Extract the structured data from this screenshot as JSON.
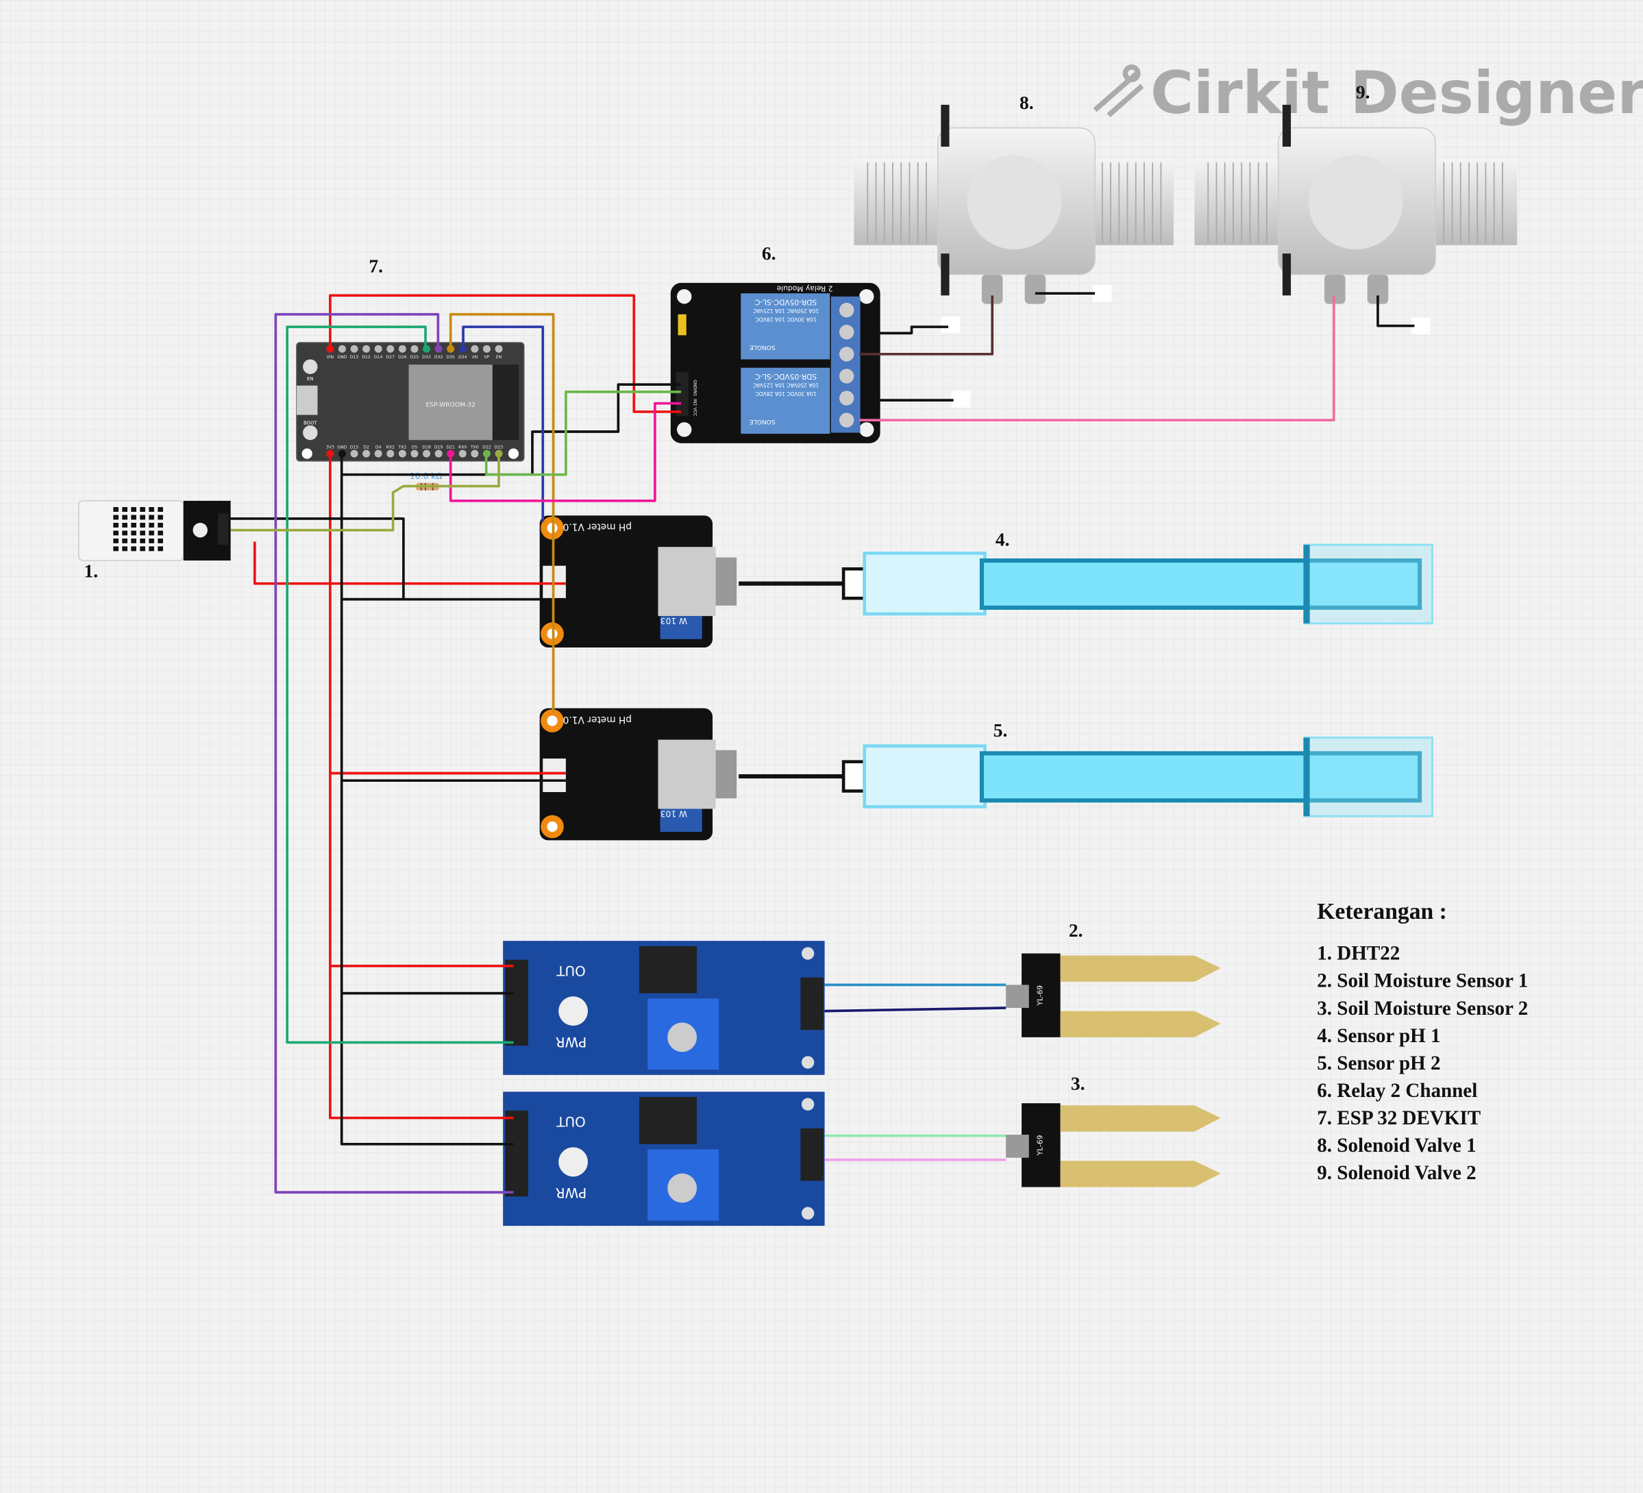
{
  "watermark": {
    "brand": "Cirkit Designer"
  },
  "component_labels": {
    "dht22": "1.",
    "soil1": "2.",
    "soil2": "3.",
    "ph1": "4.",
    "ph2": "5.",
    "relay": "6.",
    "esp32": "7.",
    "valve1": "8.",
    "valve2": "9."
  },
  "resistor": {
    "value": "10.0 kΩ"
  },
  "esp32": {
    "top_pins": [
      "VIN",
      "GND",
      "D13",
      "D12",
      "D14",
      "D27",
      "D26",
      "D25",
      "D33",
      "D32",
      "D35",
      "D34",
      "VN",
      "VP",
      "EN"
    ],
    "bottom_pins": [
      "3V3",
      "GND",
      "D15",
      "D2",
      "D4",
      "RX2",
      "TX2",
      "D5",
      "D18",
      "D19",
      "D21",
      "RX0",
      "TX0",
      "D22",
      "D23"
    ],
    "buttons": [
      "EN",
      "BOOT"
    ],
    "module": "ESP-WROOM-32"
  },
  "relay": {
    "title": "2 Relay Module",
    "relay_text": [
      "SDR-05VDC-SL-C",
      "10A 250VAC 10A 125VAC",
      "10A 30VDC 10A 28VDC",
      "SONGLE"
    ],
    "inputs": [
      "GND",
      "IN1",
      "IN2",
      "VCC"
    ]
  },
  "ph_sensor": {
    "title": "pH meter V1.0",
    "pot": "W 103"
  },
  "soil_module": {
    "labels": [
      "OUT",
      "PWR"
    ]
  },
  "soil_probe": {
    "label": "YL-69"
  },
  "legend": {
    "title": "Keterangan :",
    "items": [
      "1. DHT22",
      "2. Soil Moisture Sensor 1",
      "3. Soil Moisture Sensor 2",
      "4. Sensor pH 1",
      "5. Sensor pH 2",
      "6. Relay 2 Channel",
      "7. ESP 32 DEVKIT",
      "8. Solenoid Valve 1",
      "9. Solenoid Valve 2"
    ]
  },
  "wire_colors": {
    "red": "#ee1111",
    "black": "#111111",
    "teal": "#1aa870",
    "purple": "#7e44b8",
    "orange": "#c98a10",
    "blue": "#2a3aa8",
    "pink": "#f0159a",
    "green": "#6ab84a",
    "olive": "#9aaa40",
    "brown": "#5a3030",
    "rose": "#f06aa0",
    "lightblue": "#2a90c8",
    "navy": "#1a1a70",
    "mint": "#90e8b0",
    "lilac": "#f0a0e8"
  }
}
